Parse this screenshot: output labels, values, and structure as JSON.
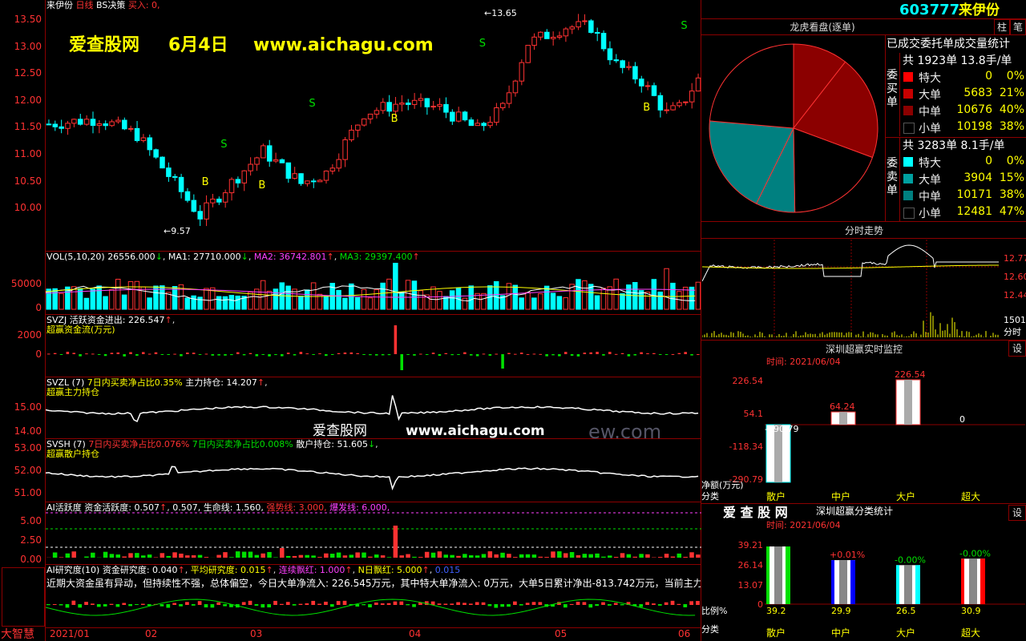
{
  "stock": {
    "code": "603777",
    "name": "来伊份"
  },
  "main_chart": {
    "title": "来伊份",
    "period": "日线",
    "indicator": "BS决策",
    "signal_text": "买入: 0,",
    "y_ticks": [
      "13.50",
      "13.00",
      "12.50",
      "12.00",
      "11.50",
      "11.00",
      "10.50",
      "10.00"
    ],
    "high_label": "13.65",
    "low_label": "9.57",
    "watermark": {
      "site": "爱查股网",
      "date": "6月4日",
      "url": "www.aichagu.com"
    }
  },
  "vol_panel": {
    "label": "VOL(5,10,20)",
    "v": "26556.000",
    "ma1": "MA1: 27710.000",
    "ma2": "MA2: 36742.801",
    "ma3": "MA3: 29397.400",
    "y_ticks": [
      "50000",
      "0"
    ]
  },
  "svzj_panel": {
    "label": "SVZJ",
    "title": "活跃资金进出: 226.547",
    "subtitle": "超赢资金流(万元)",
    "y_ticks": [
      "2000",
      "0"
    ]
  },
  "svzl_panel": {
    "label": "SVZL (7)",
    "t1": "7日内买卖净占比0.35%",
    "t2": "主力持仓: 14.207",
    "subtitle": "超赢主力持仓",
    "y_ticks": [
      "15.00",
      "14.00"
    ],
    "watermark_site": "爱查股网",
    "watermark_url": "www.aichagu.com",
    "watermark_ghost": "ew.com"
  },
  "svsh_panel": {
    "label": "SVSH (7)",
    "t1": "7日内买卖净占比0.076%",
    "t2": "7日内买卖净占比0.008%",
    "t3": "散户持仓: 51.605",
    "subtitle": "超赢散户持仓",
    "y_ticks": [
      "53.00",
      "52.00",
      "51.00"
    ]
  },
  "ai_panel": {
    "label": "AI活跃度",
    "t1": "资金活跃度: 0.507",
    "t2": "0.507,",
    "t3": "生命线: 1.560,",
    "t4": "强势线: 3.000,",
    "t5": "爆发线: 6.000,",
    "y_ticks": [
      "5.00",
      "2.50",
      "0.00"
    ]
  },
  "research_panel": {
    "label": "AI研究度(10)",
    "t1": "资金研究度: 0.040",
    "t2": "平均研究度: 0.015",
    "t3": "连续飘红: 1.000",
    "t4": "N日飘红: 5.000",
    "t5": "0.015",
    "comment": "近期大资金虽有异动，但持续性不强，总体偏空，今日大单净流入: 226.545万元，其中特大单净流入: 0万元，大单5日累计净出-813.742万元，当前主力控"
  },
  "bottom": {
    "brand": "大智慧",
    "x_labels": [
      "2021/01",
      "02",
      "03",
      "04",
      "05",
      "06"
    ]
  },
  "right": {
    "buttons": {
      "zhu": "柱",
      "bi": "笔",
      "set1": "设",
      "set2": "设"
    },
    "lhk_title": "龙虎看盘(逐单)",
    "stats_title": "已成交委托单成交量统计",
    "buy": {
      "side": "委买单",
      "summary": "共 1923单 13.8手/单",
      "rows": [
        {
          "name": "特大",
          "value": "0",
          "pct": "0%",
          "color": "#ff0000"
        },
        {
          "name": "大单",
          "value": "5683",
          "pct": "21%",
          "color": "#c80000"
        },
        {
          "name": "中单",
          "value": "10676",
          "pct": "40%",
          "color": "#8b0000"
        },
        {
          "name": "小单",
          "value": "10198",
          "pct": "38%",
          "color": "#000000"
        }
      ]
    },
    "sell": {
      "side": "委卖单",
      "summary": "共 3283单 8.1手/单",
      "rows": [
        {
          "name": "特大",
          "value": "0",
          "pct": "0%",
          "color": "#00ffff"
        },
        {
          "name": "大单",
          "value": "3904",
          "pct": "15%",
          "color": "#00a0a0"
        },
        {
          "name": "中单",
          "value": "10171",
          "pct": "38%",
          "color": "#008080"
        },
        {
          "name": "小单",
          "value": "12481",
          "pct": "47%",
          "color": "#000000"
        }
      ]
    },
    "pie": [
      {
        "label": "买-大单",
        "value": 21,
        "color": "#8b0000"
      },
      {
        "label": "买-中单",
        "value": 40,
        "color": "#8b0000"
      },
      {
        "label": "买-小单",
        "value": 38,
        "color": "#000000"
      },
      {
        "label": "卖-大单",
        "value": 15,
        "color": "#008080"
      },
      {
        "label": "卖-中单",
        "value": 38,
        "color": "#008080"
      },
      {
        "label": "卖-小单",
        "value": 47,
        "color": "#000000"
      }
    ],
    "fenshi": {
      "title": "分时走势",
      "y_ticks": [
        "12.77",
        "12.60",
        "12.44"
      ],
      "vol_label": "1501",
      "vol_unit": "分时"
    },
    "monitor": {
      "title": "深圳超赢实时监控",
      "time": "时间: 2021/06/04",
      "y_ticks": [
        "226.54",
        "54.1",
        "-118.34",
        "-290.79"
      ],
      "unit": "净额(万元)",
      "cat_label": "分类",
      "bars": [
        {
          "cat": "散户",
          "value": -290.79,
          "label": "-290.79"
        },
        {
          "cat": "中户",
          "value": 64.24,
          "label": "64.24"
        },
        {
          "cat": "大户",
          "value": 226.54,
          "label": "226.54"
        },
        {
          "cat": "超大",
          "value": 0,
          "label": "0"
        }
      ]
    },
    "classify": {
      "brand": "爱 查 股 网",
      "title": "深圳超赢分类统计",
      "time": "时间: 2021/06/04",
      "y_ticks": [
        "39.21",
        "26.14",
        "13.07",
        "0"
      ],
      "ratio_label": "比例%",
      "cat_label": "分类",
      "bars": [
        {
          "cat": "散户",
          "value": 39.2,
          "label": "39.2",
          "delta": "",
          "color": "#00e000"
        },
        {
          "cat": "中户",
          "value": 29.9,
          "label": "29.9",
          "delta": "+0.01%",
          "color": "#0000ff"
        },
        {
          "cat": "大户",
          "value": 26.5,
          "label": "26.5",
          "delta": "-0.00%",
          "color": "#00ffff"
        },
        {
          "cat": "超大",
          "value": 30.9,
          "label": "30.9",
          "delta": "-0.00%",
          "color": "#ff0000"
        }
      ]
    }
  },
  "colors": {
    "up": "#ff3232",
    "down": "#00ffff",
    "grid": "#8b0000"
  }
}
